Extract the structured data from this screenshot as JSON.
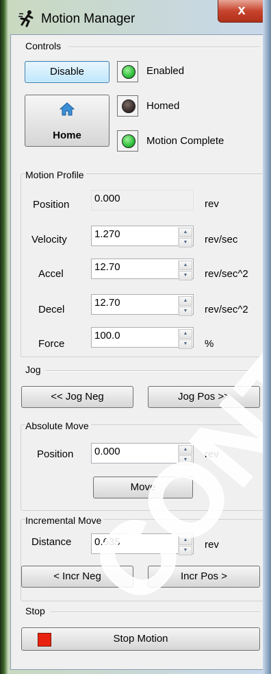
{
  "window": {
    "title": "Motion Manager",
    "close_label": "x",
    "app_icon": "running-figure-icon"
  },
  "controls": {
    "group_title": "Controls",
    "disable_label": "Disable",
    "home_label": "Home",
    "home_icon": "house-icon",
    "status": [
      {
        "label": "Enabled",
        "state": "on",
        "color": "#2fbf3a"
      },
      {
        "label": "Homed",
        "state": "off",
        "color": "#3a2e2c"
      },
      {
        "label": "Motion Complete",
        "state": "on",
        "color": "#2fbf3a"
      }
    ]
  },
  "motion_profile": {
    "group_title": "Motion Profile",
    "position": {
      "label": "Position",
      "value": "0.000",
      "unit": "rev"
    },
    "velocity": {
      "label": "Velocity",
      "value": "1.270",
      "unit": "rev/sec"
    },
    "accel": {
      "label": "Accel",
      "value": "12.70",
      "unit": "rev/sec^2"
    },
    "decel": {
      "label": "Decel",
      "value": "12.70",
      "unit": "rev/sec^2"
    },
    "force": {
      "label": "Force",
      "value": "100.0",
      "unit": "%"
    }
  },
  "jog": {
    "group_title": "Jog",
    "neg_label": "<<  Jog Neg",
    "pos_label": "Jog Pos  >>"
  },
  "absolute_move": {
    "group_title": "Absolute Move",
    "position_label": "Position",
    "position_value": "0.000",
    "unit": "rev",
    "move_label": "Move"
  },
  "incremental_move": {
    "group_title": "Incremental Move",
    "distance_label": "Distance",
    "distance_value": "0.635",
    "unit": "rev",
    "neg_label": "<  Incr Neg",
    "pos_label": "Incr Pos  >"
  },
  "stop": {
    "group_title": "Stop",
    "stop_label": "Stop Motion",
    "stop_color": "#e8220e"
  },
  "watermark": {
    "text": "CONTROL",
    "color": "#ffffff"
  }
}
